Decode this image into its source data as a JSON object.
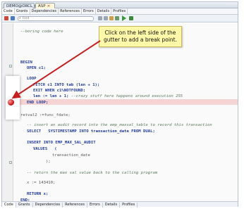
{
  "file_tabs": [
    {
      "label": "DEMO@ORCL_(DEMO)"
    },
    {
      "label": "ASP"
    }
  ],
  "editor_tabs": [
    "Code",
    "Grants",
    "Dependencies",
    "References",
    "Errors",
    "Details",
    "Profiles"
  ],
  "toolbar": {
    "find_placeholder": "Find"
  },
  "code_lines": [
    {
      "text": "--boring code here",
      "style": "cm",
      "indent": 0
    },
    {
      "text": "BEGIN",
      "style": "kw",
      "indent": 0
    },
    {
      "text": "OPEN c1;",
      "style": "kw",
      "indent": 1
    },
    {
      "text": "LOOP",
      "style": "kw",
      "indent": 1
    },
    {
      "text": "FETCH c1 INTO tab (len + 1);",
      "style": "kw",
      "indent": 2
    },
    {
      "text": "EXIT WHEN c1%NOTFOUND;",
      "style": "kw",
      "indent": 2
    },
    {
      "text": "len := len + 1; --crazy stuff here happens around execution 255",
      "style": "bp",
      "indent": 2
    },
    {
      "text": "END LOOP;",
      "style": "kw",
      "indent": 1
    },
    {
      "text": "retval2 :=func_fdate;",
      "style": "dim",
      "indent": 0
    },
    {
      "text": "-- insert an audit record into the emp_maxsal_table to record this transaction",
      "style": "cm",
      "indent": 1
    },
    {
      "text": "SELECT   SYSTIMESTAMP INTO transaction_date FROM DUAL;",
      "style": "kw",
      "indent": 1
    },
    {
      "text": "INSERT INTO EMP_MAX_SAL_AUDIT",
      "style": "kw",
      "indent": 1
    },
    {
      "text": "VALUES   (",
      "style": "kw",
      "indent": 2
    },
    {
      "text": "transaction_date",
      "style": "dim",
      "indent": 5
    },
    {
      "text": ");",
      "style": "dim",
      "indent": 4
    },
    {
      "text": "-- return the max sal value back to the calling program",
      "style": "cm",
      "indent": 1
    },
    {
      "text": "x := 143410;",
      "style": "dim",
      "indent": 1
    },
    {
      "text": "RETURN x;",
      "style": "kw",
      "indent": 1
    },
    {
      "text": "END;",
      "style": "kw",
      "indent": 0
    }
  ],
  "callout": {
    "line1": "Click on the left side of the",
    "line2": "gutter to add a break point."
  },
  "colors": {
    "breakpoint": "#d11a1a",
    "callout_bg": "#fff8a8",
    "arrow": "#c81e1e"
  }
}
